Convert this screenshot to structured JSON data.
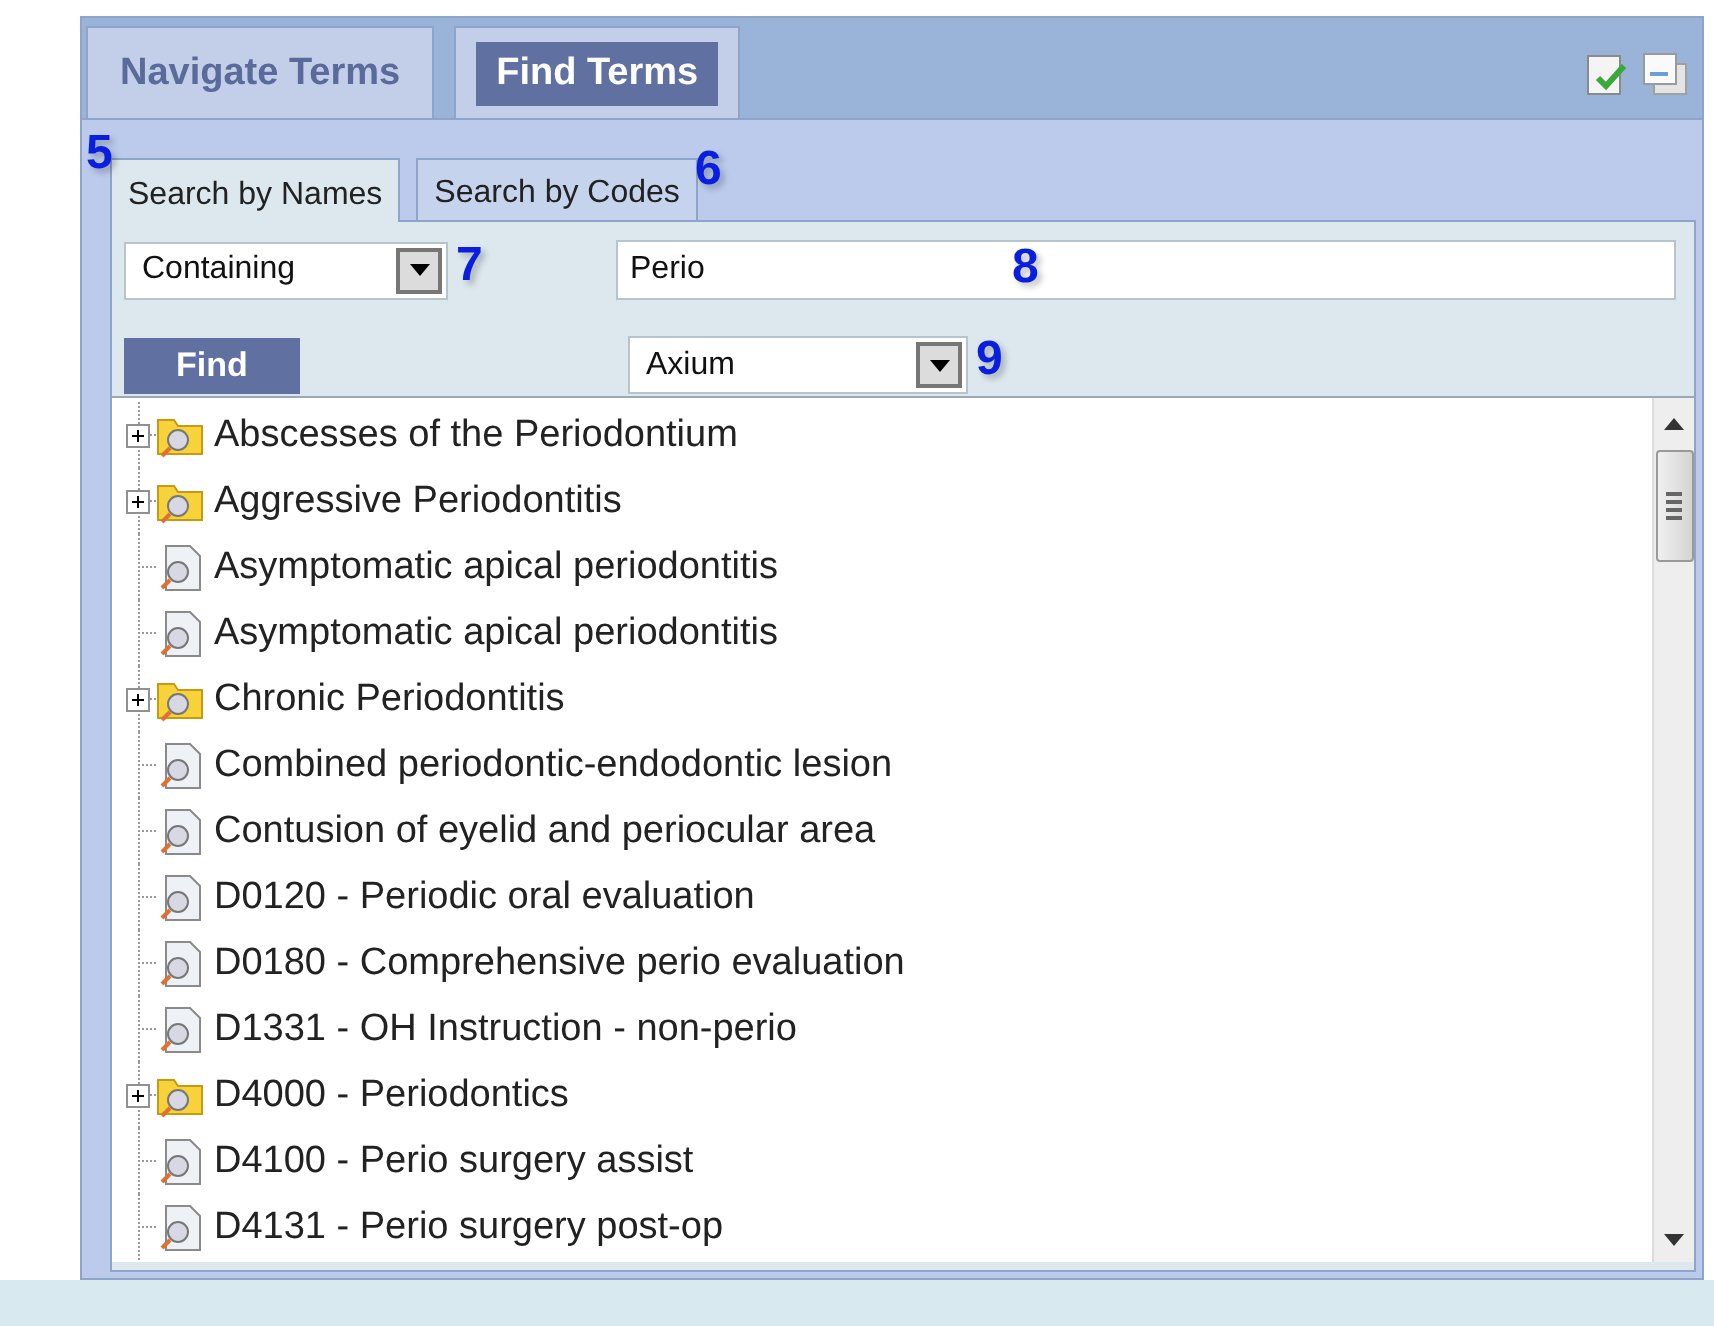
{
  "tabs": [
    {
      "label": "Navigate Terms",
      "selected": false
    },
    {
      "label": "Find Terms",
      "selected": true
    }
  ],
  "subtabs": [
    {
      "label": "Search by Names",
      "selected": true,
      "callout": "5"
    },
    {
      "label": "Search by Codes",
      "selected": false,
      "callout": "6"
    }
  ],
  "match_mode": {
    "value": "Containing",
    "callout": "7"
  },
  "search_field": {
    "value": "Perio",
    "callout": "8"
  },
  "find_button": "Find",
  "source_select": {
    "value": "Axium",
    "callout": "9"
  },
  "tree": [
    {
      "label": "Abscesses of the Periodontium",
      "kind": "folder",
      "expanded": false
    },
    {
      "label": "Aggressive Periodontitis",
      "kind": "folder",
      "expanded": false
    },
    {
      "label": "Asymptomatic apical periodontitis",
      "kind": "leaf"
    },
    {
      "label": "Asymptomatic apical periodontitis",
      "kind": "leaf"
    },
    {
      "label": "Chronic Periodontitis",
      "kind": "folder",
      "expanded": false
    },
    {
      "label": "Combined periodontic-endodontic lesion",
      "kind": "leaf"
    },
    {
      "label": "Contusion of eyelid and periocular area",
      "kind": "leaf"
    },
    {
      "label": "D0120 - Periodic oral evaluation",
      "kind": "leaf"
    },
    {
      "label": "D0180 - Comprehensive perio evaluation",
      "kind": "leaf"
    },
    {
      "label": "D1331 - OH Instruction - non-perio",
      "kind": "leaf"
    },
    {
      "label": "D4000 - Periodontics",
      "kind": "folder",
      "expanded": false
    },
    {
      "label": "D4100 - Perio surgery assist",
      "kind": "leaf"
    },
    {
      "label": "D4131 - Perio surgery post-op",
      "kind": "leaf"
    }
  ]
}
